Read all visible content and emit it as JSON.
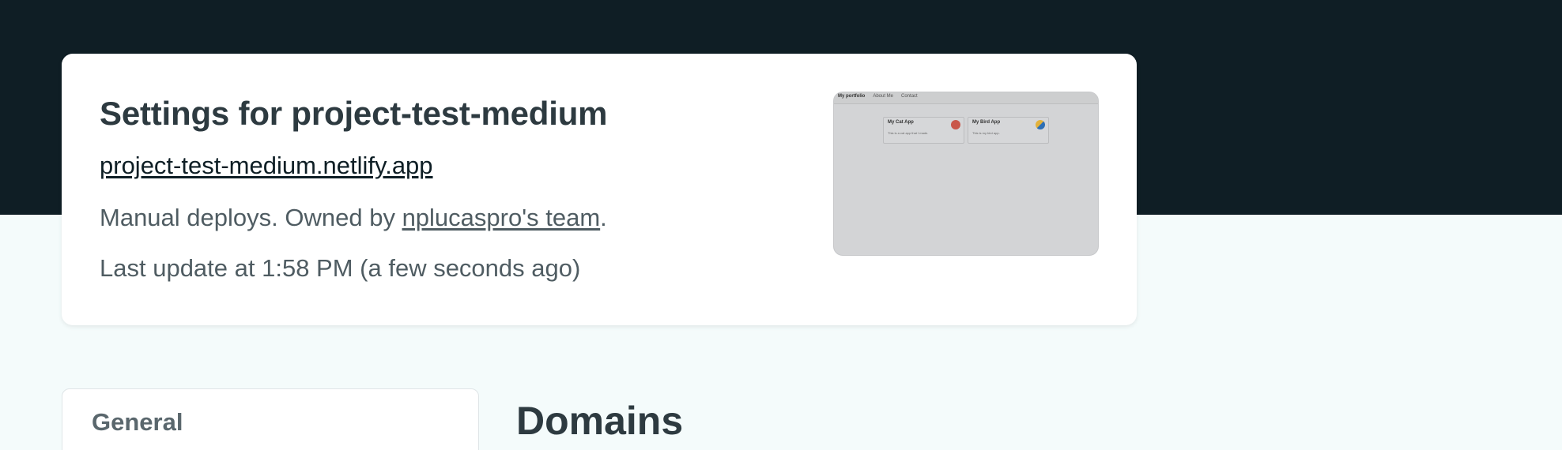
{
  "site": {
    "title": "Settings for project-test-medium",
    "url": "project-test-medium.netlify.app",
    "deploy_mode": "Manual deploys. Owned by ",
    "owner": "nplucaspro's team",
    "owner_suffix": ".",
    "last_update": "Last update at 1:58 PM (a few seconds ago)"
  },
  "preview": {
    "nav": [
      "My portfolio",
      "About Me",
      "Contact"
    ],
    "cards": [
      {
        "title": "My Cat App",
        "text": "This is a cat app that I made.",
        "icon": "cat-emoji-icon"
      },
      {
        "title": "My Bird App",
        "text": "This is my bird app.",
        "icon": "bird-emoji-icon"
      }
    ]
  },
  "sidebar": {
    "items": [
      {
        "label": "General"
      }
    ]
  },
  "main": {
    "section_title": "Domains"
  },
  "colors": {
    "header_bg": "#0f1e25",
    "page_bg": "#f4fbfb",
    "card_bg": "#ffffff",
    "text": "#2d3a40"
  }
}
